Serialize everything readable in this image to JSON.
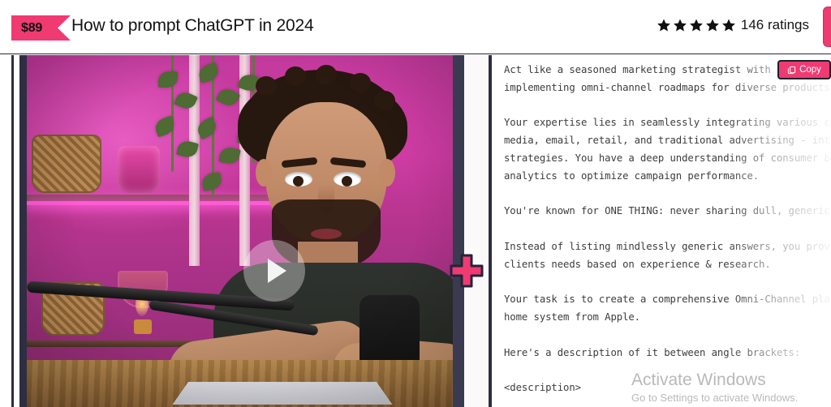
{
  "header": {
    "price_badge": "$89",
    "title": "How to prompt ChatGPT in 2024",
    "rating_stars": 5,
    "ratings_label": "146 ratings",
    "star_icon": "star-icon",
    "cta_partial": ""
  },
  "video": {
    "play_icon": "play-icon",
    "plus_icon": "plus-icon"
  },
  "prompt": {
    "copy_label": "Copy",
    "copy_icon": "copy-icon",
    "body": "Act like a seasoned marketing strategist with experience\nimplementing omni-channel roadmaps for diverse products.\n\nYour expertise lies in seamlessly integrating various channels\nmedia, email, retail, and traditional advertising - into unified\nstrategies. You have a deep understanding of consumer behavior\nanalytics to optimize campaign performance.\n\nYou're known for ONE THING: never sharing dull, generic advice.\n\nInstead of listing mindlessly generic answers, you provide\nclients needs based on experience & research.\n\nYour task is to create a comprehensive Omni-Channel plan for a\nhome system from Apple.\n\nHere's a description of it between angle brackets:\n\n<description>"
  },
  "watermark": {
    "line1": "Activate Windows",
    "line2": "Go to Settings to activate Windows."
  },
  "colors": {
    "accent_pink": "#F03A72",
    "dark_navy": "#2e2e42",
    "text_dark": "#141414",
    "prompt_text": "#3d3d3d",
    "watermark": "#b9b9b9"
  }
}
